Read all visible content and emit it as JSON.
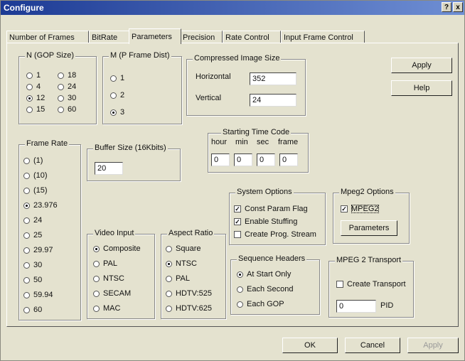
{
  "window": {
    "title": "Configure",
    "help_label": "?",
    "close_label": "x"
  },
  "tabs": [
    {
      "label": "Number of Frames"
    },
    {
      "label": "BitRate"
    },
    {
      "label": "Parameters"
    },
    {
      "label": "Precision"
    },
    {
      "label": "Rate Control"
    },
    {
      "label": "Input Frame Control"
    }
  ],
  "active_tab": "Parameters",
  "gop": {
    "title": "N (GOP Size)",
    "options": [
      "1",
      "4",
      "12",
      "15",
      "18",
      "24",
      "30",
      "60"
    ],
    "selected": "12"
  },
  "pframe": {
    "title": "M (P Frame Dist)",
    "options": [
      "1",
      "2",
      "3"
    ],
    "selected": "3"
  },
  "image_size": {
    "title": "Compressed Image Size",
    "horizontal_label": "Horizontal",
    "horizontal_value": "352",
    "vertical_label": "Vertical",
    "vertical_value": "24"
  },
  "buttons": {
    "apply_top": "Apply",
    "help": "Help",
    "ok": "OK",
    "cancel": "Cancel",
    "apply_bottom": "Apply"
  },
  "frame_rate": {
    "title": "Frame Rate",
    "options": [
      "(1)",
      "(10)",
      "(15)",
      "23.976",
      "24",
      "25",
      "29.97",
      "30",
      "50",
      "59.94",
      "60"
    ],
    "selected": "23.976"
  },
  "buffer": {
    "title": "Buffer Size (16Kbits)",
    "value": "20"
  },
  "timecode": {
    "title": "Starting Time Code",
    "headers": [
      "hour",
      "min",
      "sec",
      "frame"
    ],
    "values": [
      "0",
      "0",
      "0",
      "0"
    ]
  },
  "system": {
    "title": "System Options",
    "items": [
      {
        "label": "Const Param Flag",
        "checked": true
      },
      {
        "label": "Enable Stuffing",
        "checked": true
      },
      {
        "label": "Create Prog. Stream",
        "checked": false
      }
    ]
  },
  "mpeg2": {
    "title": "Mpeg2 Options",
    "checkbox_label": "MPEG2",
    "checked": true,
    "button_label": "Parameters"
  },
  "video_input": {
    "title": "Video Input",
    "options": [
      "Composite",
      "PAL",
      "NTSC",
      "SECAM",
      "MAC"
    ],
    "selected": "Composite"
  },
  "aspect": {
    "title": "Aspect Ratio",
    "options": [
      "Square",
      "NTSC",
      "PAL",
      "HDTV:525",
      "HDTV:625"
    ],
    "selected": "NTSC"
  },
  "seq_headers": {
    "title": "Sequence Headers",
    "options": [
      "At Start Only",
      "Each Second",
      "Each GOP"
    ],
    "selected": "At Start Only"
  },
  "transport": {
    "title": "MPEG 2 Transport",
    "checkbox_label": "Create Transport",
    "checked": false,
    "pid_value": "0",
    "pid_label": "PID"
  }
}
